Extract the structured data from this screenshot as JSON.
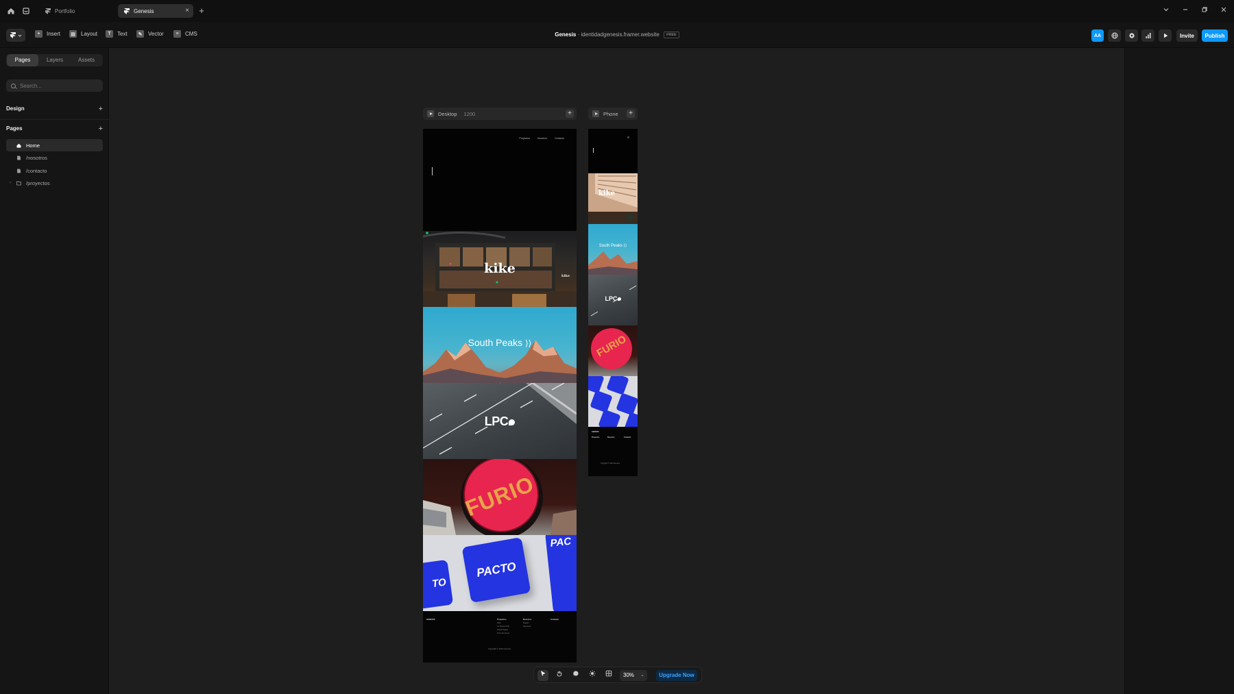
{
  "titlebar": {
    "tabs": [
      {
        "label": "Portfolio",
        "active": false
      },
      {
        "label": "Genesis",
        "active": true
      }
    ],
    "new_tab": "+",
    "close": "×"
  },
  "toolbar": {
    "insert": "Insert",
    "layout": "Layout",
    "text": "Text",
    "vector": "Vector",
    "cms": "CMS",
    "project_name": "Genesis",
    "separator": "·",
    "site_url": "identidadgenesis.framer.website",
    "plan_badge": "FREE",
    "aa_label": "AA",
    "invite": "Invite",
    "publish": "Publish"
  },
  "sidebar": {
    "tabs": [
      "Pages",
      "Layers",
      "Assets"
    ],
    "active_tab": "Pages",
    "search_placeholder": "Search...",
    "design_header": "Design",
    "pages_header": "Pages",
    "pages": [
      {
        "label": "Home",
        "icon": "home-icon",
        "active": true
      },
      {
        "label": "/nosotros",
        "icon": "page-icon",
        "active": false
      },
      {
        "label": "/contacto",
        "icon": "page-icon",
        "active": false
      },
      {
        "label": "/proyectos",
        "icon": "folder-icon",
        "active": false
      }
    ]
  },
  "canvas": {
    "desktop_frame": {
      "name": "Desktop",
      "width": "1200"
    },
    "phone_frame": {
      "name": "Phone"
    },
    "desktop_nav": [
      "Proyectos",
      "Nosotros",
      "Contacto"
    ],
    "logos": {
      "kike": "kike",
      "south_peaks": "South Peaks",
      "lpc": "LPC",
      "furio": "FURIO",
      "pacto": "PACTO",
      "pacto_left": "TO",
      "pacto_right": "PAC"
    },
    "footer": {
      "brand": "GENESIS",
      "col1_title": "Proyectos",
      "col1_items": [
        "Kike",
        "La Pesca Club",
        "South Peaks",
        "Furio Grocerie"
      ],
      "col2_title": "Nosotros",
      "col2_items": [
        "Equipo",
        "Servicios"
      ],
      "col3_title": "Contacto",
      "copyright": "Copyright © 2024 Genesis"
    }
  },
  "bottombar": {
    "zoom": "30%",
    "upgrade": "Upgrade Now"
  },
  "colors": {
    "accent": "#0d99ff",
    "background": "#1e1e1e"
  }
}
